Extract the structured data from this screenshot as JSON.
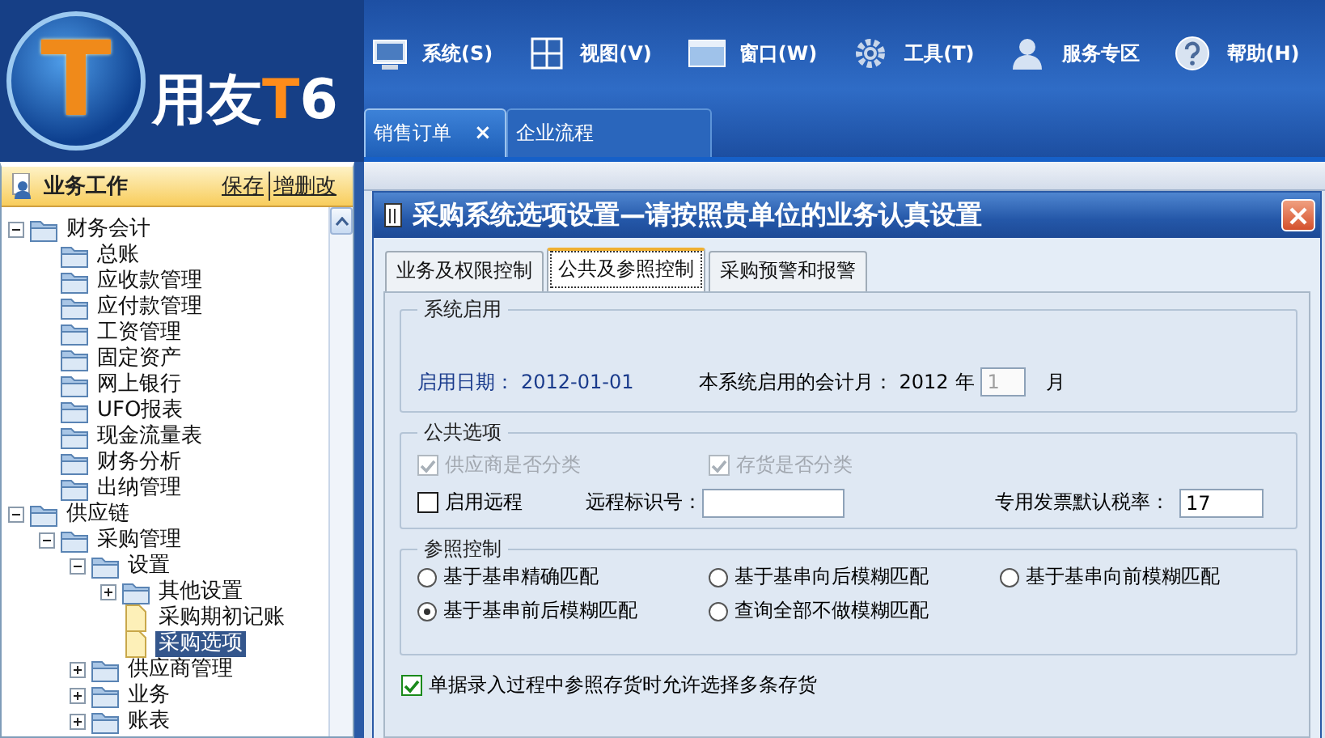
{
  "app": {
    "logo_letter": "T",
    "logo_parts": [
      {
        "text": "用友",
        "accent": false
      },
      {
        "text": "T",
        "accent": true
      },
      {
        "text": "6",
        "accent": false
      }
    ]
  },
  "menu": [
    {
      "label": "系统(S)"
    },
    {
      "label": "视图(V)"
    },
    {
      "label": "窗口(W)"
    },
    {
      "label": "工具(T)"
    },
    {
      "label": "服务专区"
    },
    {
      "label": "帮助(H)"
    }
  ],
  "doc_tabs": [
    {
      "label": "销售订单",
      "selected": true,
      "close": "×"
    },
    {
      "label": "企业流程",
      "selected": false
    }
  ],
  "sidebar": {
    "title": "业务工作",
    "links": [
      "保存",
      "增删改"
    ],
    "tree": [
      {
        "label": "财务会计",
        "kind": "folder",
        "expanded": true,
        "selected": false,
        "children": [
          {
            "label": "总账",
            "kind": "folder",
            "selected": false
          },
          {
            "label": "应收款管理",
            "kind": "folder",
            "selected": false
          },
          {
            "label": "应付款管理",
            "kind": "folder",
            "selected": false
          },
          {
            "label": "工资管理",
            "kind": "folder",
            "selected": false
          },
          {
            "label": "固定资产",
            "kind": "folder",
            "selected": false
          },
          {
            "label": "网上银行",
            "kind": "folder",
            "selected": false
          },
          {
            "label": "UFO报表",
            "kind": "folder",
            "selected": false
          },
          {
            "label": "现金流量表",
            "kind": "folder",
            "selected": false
          },
          {
            "label": "财务分析",
            "kind": "folder",
            "selected": false
          },
          {
            "label": "出纳管理",
            "kind": "folder",
            "selected": false
          }
        ]
      },
      {
        "label": "供应链",
        "kind": "folder",
        "expanded": true,
        "selected": false,
        "children": [
          {
            "label": "采购管理",
            "kind": "folder",
            "expanded": true,
            "selected": false,
            "children": [
              {
                "label": "设置",
                "kind": "folder",
                "expanded": true,
                "selected": false,
                "children": [
                  {
                    "label": "其他设置",
                    "kind": "folder",
                    "expanded": false,
                    "selected": false
                  },
                  {
                    "label": "采购期初记账",
                    "kind": "document",
                    "selected": false
                  },
                  {
                    "label": "采购选项",
                    "kind": "document",
                    "selected": true
                  }
                ]
              },
              {
                "label": "供应商管理",
                "kind": "folder",
                "expanded": false,
                "selected": false
              },
              {
                "label": "业务",
                "kind": "folder",
                "expanded": false,
                "selected": false
              },
              {
                "label": "账表",
                "kind": "folder",
                "expanded": false,
                "selected": false
              }
            ]
          }
        ]
      }
    ]
  },
  "dialog": {
    "title": "采购系统选项设置—请按照贵单位的业务认真设置",
    "tabs": [
      {
        "label": "业务及权限控制",
        "selected": false
      },
      {
        "label": "公共及参照控制",
        "selected": true
      },
      {
        "label": "采购预警和报警",
        "selected": false
      }
    ],
    "system_start": {
      "title": "系统启用",
      "start_date_label": "启用日期：",
      "start_date": "2012-01-01",
      "month_label": "本系统启用的会计月：",
      "year": "2012",
      "year_unit": "年",
      "month_value": "1",
      "month_disabled": true,
      "month_unit": "月"
    },
    "public_options": {
      "title": "公共选项",
      "checks": [
        {
          "label": "供应商是否分类",
          "checked": true,
          "disabled": true
        },
        {
          "label": "存货是否分类",
          "checked": true,
          "disabled": true
        },
        {
          "label": "启用远程",
          "checked": false,
          "disabled": false
        }
      ],
      "remote_id_label": "远程标识号：",
      "tax_label": "专用发票默认税率：",
      "tax_value": "17"
    },
    "reference": {
      "title": "参照控制",
      "radios": [
        {
          "label": "基于基串精确匹配",
          "selected": false
        },
        {
          "label": "基于基串向后模糊匹配",
          "selected": false
        },
        {
          "label": "基于基串向前模糊匹配",
          "selected": false
        },
        {
          "label": "基于基串前后模糊匹配",
          "selected": true
        },
        {
          "label": "查询全部不做模糊匹配",
          "selected": false
        }
      ]
    },
    "multi_select": {
      "label": "单据录入过程中参照存货时允许选择多条存货",
      "checked": true
    }
  }
}
